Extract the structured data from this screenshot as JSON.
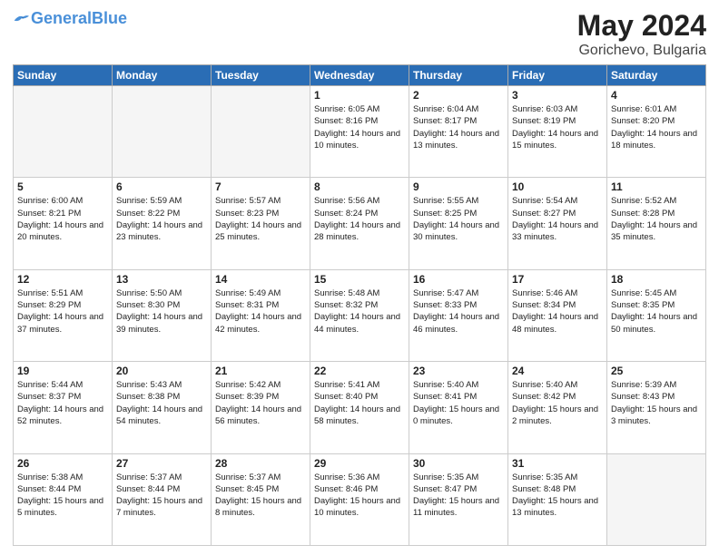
{
  "header": {
    "logo_general": "General",
    "logo_blue": "Blue",
    "month_year": "May 2024",
    "location": "Gorichevo, Bulgaria"
  },
  "weekdays": [
    "Sunday",
    "Monday",
    "Tuesday",
    "Wednesday",
    "Thursday",
    "Friday",
    "Saturday"
  ],
  "weeks": [
    [
      {
        "day": "",
        "empty": true
      },
      {
        "day": "",
        "empty": true
      },
      {
        "day": "",
        "empty": true
      },
      {
        "day": "1",
        "sunrise": "6:05 AM",
        "sunset": "8:16 PM",
        "daylight": "14 hours and 10 minutes."
      },
      {
        "day": "2",
        "sunrise": "6:04 AM",
        "sunset": "8:17 PM",
        "daylight": "14 hours and 13 minutes."
      },
      {
        "day": "3",
        "sunrise": "6:03 AM",
        "sunset": "8:19 PM",
        "daylight": "14 hours and 15 minutes."
      },
      {
        "day": "4",
        "sunrise": "6:01 AM",
        "sunset": "8:20 PM",
        "daylight": "14 hours and 18 minutes."
      }
    ],
    [
      {
        "day": "5",
        "sunrise": "6:00 AM",
        "sunset": "8:21 PM",
        "daylight": "14 hours and 20 minutes."
      },
      {
        "day": "6",
        "sunrise": "5:59 AM",
        "sunset": "8:22 PM",
        "daylight": "14 hours and 23 minutes."
      },
      {
        "day": "7",
        "sunrise": "5:57 AM",
        "sunset": "8:23 PM",
        "daylight": "14 hours and 25 minutes."
      },
      {
        "day": "8",
        "sunrise": "5:56 AM",
        "sunset": "8:24 PM",
        "daylight": "14 hours and 28 minutes."
      },
      {
        "day": "9",
        "sunrise": "5:55 AM",
        "sunset": "8:25 PM",
        "daylight": "14 hours and 30 minutes."
      },
      {
        "day": "10",
        "sunrise": "5:54 AM",
        "sunset": "8:27 PM",
        "daylight": "14 hours and 33 minutes."
      },
      {
        "day": "11",
        "sunrise": "5:52 AM",
        "sunset": "8:28 PM",
        "daylight": "14 hours and 35 minutes."
      }
    ],
    [
      {
        "day": "12",
        "sunrise": "5:51 AM",
        "sunset": "8:29 PM",
        "daylight": "14 hours and 37 minutes."
      },
      {
        "day": "13",
        "sunrise": "5:50 AM",
        "sunset": "8:30 PM",
        "daylight": "14 hours and 39 minutes."
      },
      {
        "day": "14",
        "sunrise": "5:49 AM",
        "sunset": "8:31 PM",
        "daylight": "14 hours and 42 minutes."
      },
      {
        "day": "15",
        "sunrise": "5:48 AM",
        "sunset": "8:32 PM",
        "daylight": "14 hours and 44 minutes."
      },
      {
        "day": "16",
        "sunrise": "5:47 AM",
        "sunset": "8:33 PM",
        "daylight": "14 hours and 46 minutes."
      },
      {
        "day": "17",
        "sunrise": "5:46 AM",
        "sunset": "8:34 PM",
        "daylight": "14 hours and 48 minutes."
      },
      {
        "day": "18",
        "sunrise": "5:45 AM",
        "sunset": "8:35 PM",
        "daylight": "14 hours and 50 minutes."
      }
    ],
    [
      {
        "day": "19",
        "sunrise": "5:44 AM",
        "sunset": "8:37 PM",
        "daylight": "14 hours and 52 minutes."
      },
      {
        "day": "20",
        "sunrise": "5:43 AM",
        "sunset": "8:38 PM",
        "daylight": "14 hours and 54 minutes."
      },
      {
        "day": "21",
        "sunrise": "5:42 AM",
        "sunset": "8:39 PM",
        "daylight": "14 hours and 56 minutes."
      },
      {
        "day": "22",
        "sunrise": "5:41 AM",
        "sunset": "8:40 PM",
        "daylight": "14 hours and 58 minutes."
      },
      {
        "day": "23",
        "sunrise": "5:40 AM",
        "sunset": "8:41 PM",
        "daylight": "15 hours and 0 minutes."
      },
      {
        "day": "24",
        "sunrise": "5:40 AM",
        "sunset": "8:42 PM",
        "daylight": "15 hours and 2 minutes."
      },
      {
        "day": "25",
        "sunrise": "5:39 AM",
        "sunset": "8:43 PM",
        "daylight": "15 hours and 3 minutes."
      }
    ],
    [
      {
        "day": "26",
        "sunrise": "5:38 AM",
        "sunset": "8:44 PM",
        "daylight": "15 hours and 5 minutes."
      },
      {
        "day": "27",
        "sunrise": "5:37 AM",
        "sunset": "8:44 PM",
        "daylight": "15 hours and 7 minutes."
      },
      {
        "day": "28",
        "sunrise": "5:37 AM",
        "sunset": "8:45 PM",
        "daylight": "15 hours and 8 minutes."
      },
      {
        "day": "29",
        "sunrise": "5:36 AM",
        "sunset": "8:46 PM",
        "daylight": "15 hours and 10 minutes."
      },
      {
        "day": "30",
        "sunrise": "5:35 AM",
        "sunset": "8:47 PM",
        "daylight": "15 hours and 11 minutes."
      },
      {
        "day": "31",
        "sunrise": "5:35 AM",
        "sunset": "8:48 PM",
        "daylight": "15 hours and 13 minutes."
      },
      {
        "day": "",
        "empty": true
      }
    ]
  ]
}
